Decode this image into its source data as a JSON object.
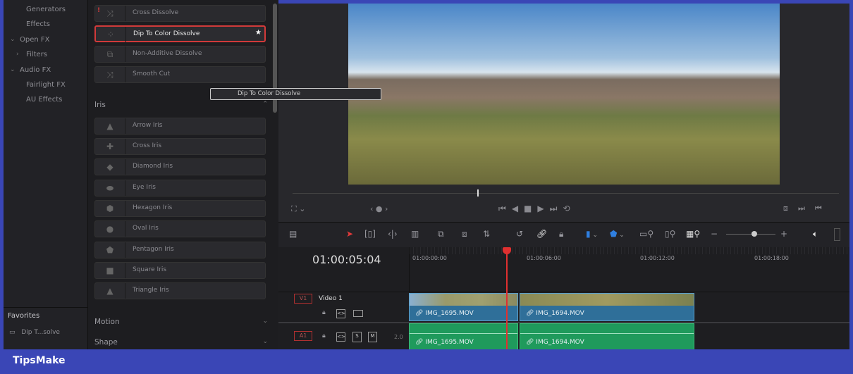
{
  "sidebar": {
    "items": [
      {
        "label": "Generators"
      },
      {
        "label": "Effects"
      },
      {
        "label": "Open FX"
      },
      {
        "label": "Filters"
      },
      {
        "label": "Audio FX"
      },
      {
        "label": "Fairlight FX"
      },
      {
        "label": "AU Effects"
      }
    ],
    "favorites_title": "Favorites",
    "favorites": [
      {
        "label": "Dip T...solve"
      }
    ]
  },
  "effects": {
    "dissolve": [
      {
        "label": "Cross Dissolve"
      },
      {
        "label": "Dip To Color Dissolve"
      },
      {
        "label": "Non-Additive Dissolve"
      },
      {
        "label": "Smooth Cut"
      }
    ],
    "iris_title": "Iris",
    "iris": [
      {
        "label": "Arrow Iris"
      },
      {
        "label": "Cross Iris"
      },
      {
        "label": "Diamond Iris"
      },
      {
        "label": "Eye Iris"
      },
      {
        "label": "Hexagon Iris"
      },
      {
        "label": "Oval Iris"
      },
      {
        "label": "Pentagon Iris"
      },
      {
        "label": "Square Iris"
      },
      {
        "label": "Triangle Iris"
      }
    ],
    "motion_title": "Motion",
    "shape_title": "Shape",
    "drag_ghost": "Dip To Color Dissolve"
  },
  "timeline": {
    "timecode": "01:00:05:04",
    "ruler": [
      "01:00:00:00",
      "01:00:06:00",
      "01:00:12:00",
      "01:00:18:00"
    ],
    "v1": {
      "badge": "V1",
      "name": "Video 1",
      "clips": [
        "IMG_1695.MOV",
        "IMG_1694.MOV"
      ]
    },
    "a1": {
      "badge": "A1",
      "level": "2.0",
      "solo": "S",
      "mute": "M",
      "clips": [
        "IMG_1695.MOV",
        "IMG_1694.MOV"
      ]
    }
  },
  "watermark": "TipsMake",
  "colors": {
    "accent": "#d13a3a",
    "video_clip": "#2f6f99",
    "audio_clip": "#1f9a5c",
    "frame": "#3a46b6"
  }
}
